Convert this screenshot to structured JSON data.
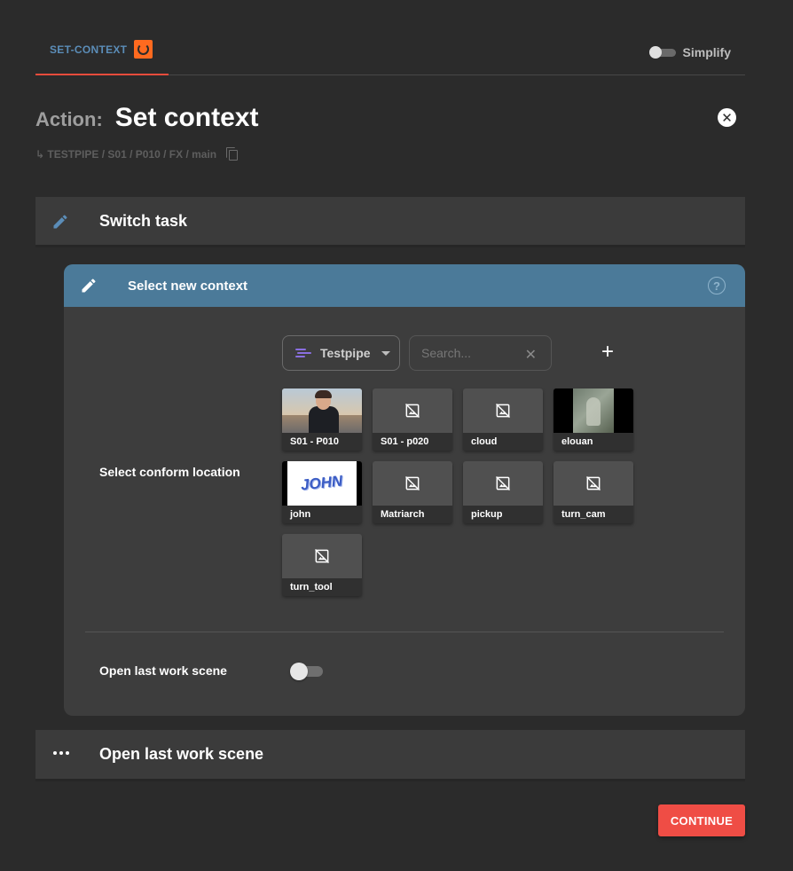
{
  "tabs": [
    {
      "label": "SET-CONTEXT",
      "icon": "houdini-icon",
      "active": true
    }
  ],
  "simplify": {
    "label": "Simplify",
    "on": false
  },
  "action": {
    "prefix": "Action:",
    "title": "Set context"
  },
  "breadcrumb": {
    "path": "↳ TESTPIPE / S01 / P010 / FX / main"
  },
  "panels": {
    "switch_task": {
      "title": "Switch task",
      "icon": "pencil-icon"
    },
    "select_context": {
      "title": "Select new context",
      "icon": "pencil-icon",
      "help_icon": "help-icon",
      "project": {
        "label": "Testpipe",
        "icon": "wind-icon"
      },
      "search": {
        "placeholder": "Search...",
        "value": ""
      },
      "conform_label": "Select conform location",
      "items": [
        {
          "label": "S01 - P010",
          "thumb": "person"
        },
        {
          "label": "S01 - p020",
          "thumb": "none"
        },
        {
          "label": "cloud",
          "thumb": "none"
        },
        {
          "label": "elouan",
          "thumb": "statue"
        },
        {
          "label": "john",
          "thumb": "john",
          "thumb_text": "JOHN"
        },
        {
          "label": "Matriarch",
          "thumb": "none"
        },
        {
          "label": "pickup",
          "thumb": "none"
        },
        {
          "label": "turn_cam",
          "thumb": "none"
        },
        {
          "label": "turn_tool",
          "thumb": "none"
        }
      ],
      "open_last": {
        "label": "Open last work scene",
        "on": false
      }
    },
    "open_last_work_scene": {
      "title": "Open last work scene",
      "icon": "dots-icon"
    }
  },
  "continue_button": {
    "label": "CONTINUE"
  },
  "colors": {
    "background": "#2b2b2b",
    "panel": "#3b3b3b",
    "active_header": "#4b7a99",
    "accent_red": "#ef4d45",
    "tab_text": "#5b8db8"
  }
}
